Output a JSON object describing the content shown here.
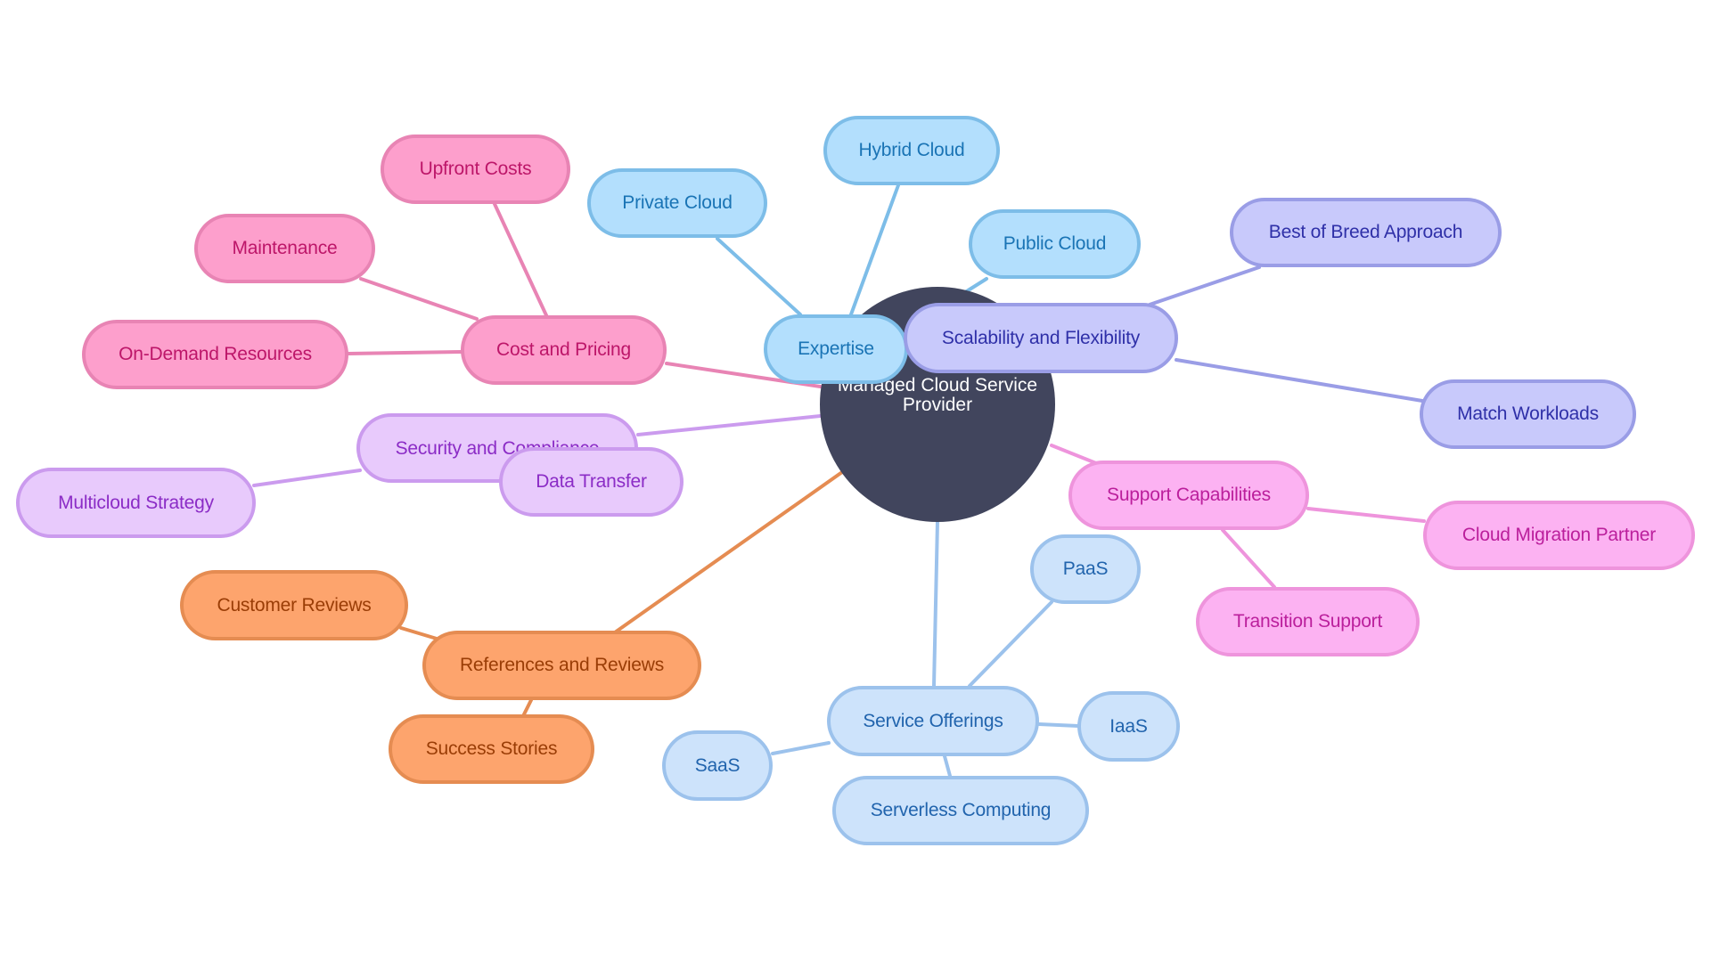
{
  "root": {
    "line1": "Managed Cloud Service",
    "line2": "Provider"
  },
  "branches": {
    "expertise": {
      "label": "Expertise",
      "color": "#7dbde8",
      "children": [
        "Hybrid Cloud",
        "Private Cloud",
        "Public Cloud"
      ]
    },
    "scalability": {
      "label": "Scalability and Flexibility",
      "color": "#9a9de6",
      "children": [
        "Best of Breed Approach",
        "Match Workloads"
      ]
    },
    "support": {
      "label": "Support Capabilities",
      "color": "#ee94dc",
      "children": [
        "Cloud Migration Partner",
        "Transition Support"
      ]
    },
    "service": {
      "label": "Service Offerings",
      "color": "#9cc2ec",
      "children": [
        "PaaS",
        "IaaS",
        "SaaS",
        "Serverless Computing"
      ]
    },
    "references": {
      "label": "References and Reviews",
      "color": "#e58c52",
      "children": [
        "Customer Reviews",
        "Success Stories"
      ]
    },
    "security": {
      "label": "Security and Compliance",
      "color": "#cb9bee",
      "children": [
        "Data Transfer",
        "Multicloud Strategy"
      ]
    },
    "cost": {
      "label": "Cost and Pricing",
      "color": "#e884b4",
      "children": [
        "Upfront Costs",
        "Maintenance",
        "On-Demand Resources"
      ]
    }
  }
}
